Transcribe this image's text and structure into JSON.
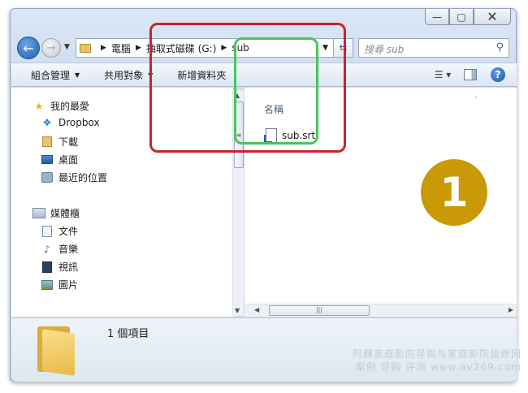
{
  "window": {
    "caption": {
      "minimize": "—",
      "maximize": "▢",
      "close": "✕"
    }
  },
  "address": {
    "crumbs": [
      "電腦",
      "抽取式磁碟 (G:)",
      "sub"
    ],
    "search_placeholder": "搜尋 sub"
  },
  "toolbar": {
    "organize": "組合管理",
    "share": "共用對象",
    "new_folder": "新增資料夾"
  },
  "navigation": {
    "favorites": {
      "header": "我的最愛",
      "items": [
        "Dropbox",
        "下載",
        "桌面",
        "最近的位置"
      ]
    },
    "libraries": {
      "header": "媒體櫃",
      "items": [
        "文件",
        "音樂",
        "視訊",
        "圖片"
      ]
    }
  },
  "file_list": {
    "column_name": "名稱",
    "files": [
      {
        "name": "sub.srt"
      }
    ]
  },
  "details": {
    "count": "1 個項目"
  },
  "badge": "1",
  "watermark": {
    "line1": "阿輝家庭影院导购与家庭影院装修网",
    "line2": "案例 导购 评测 www.av269.com"
  }
}
